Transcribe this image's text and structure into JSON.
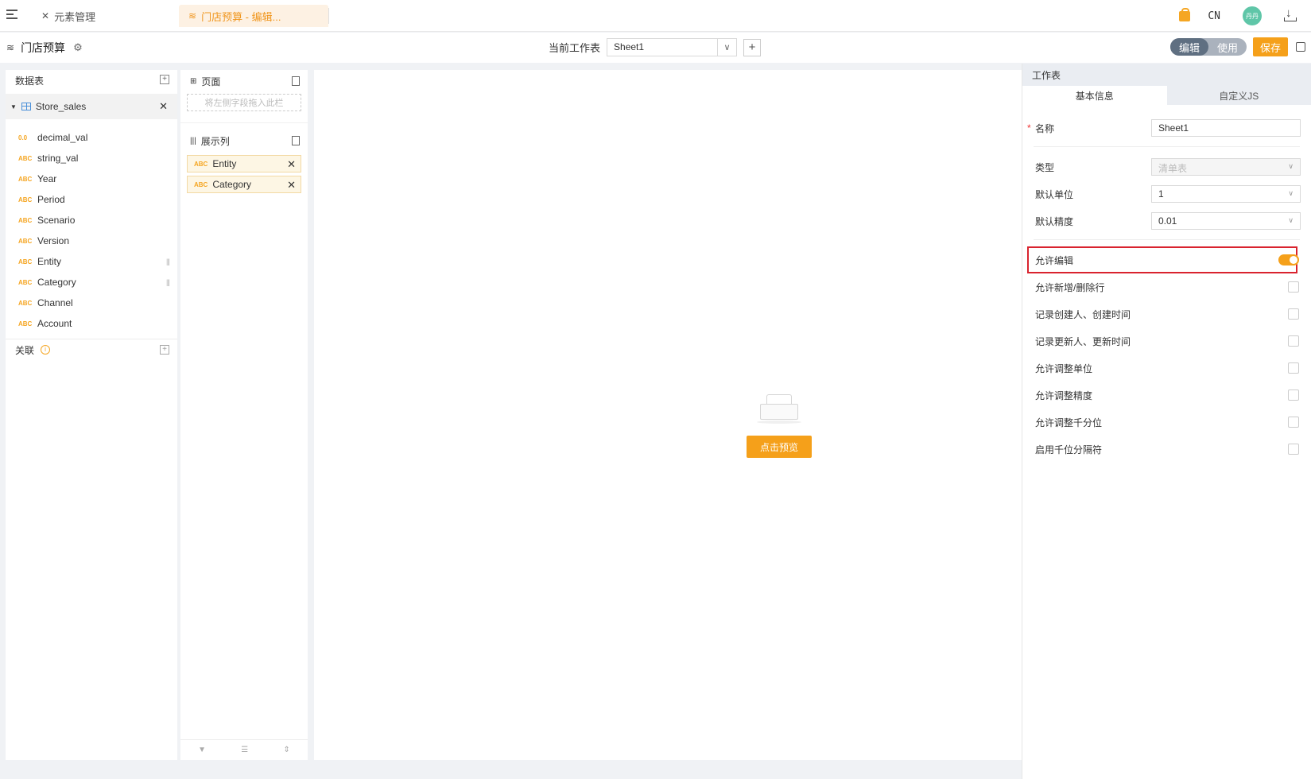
{
  "topbar": {
    "tabs": [
      {
        "label": "元素管理",
        "icon": "tools-icon"
      },
      {
        "label": "门店预算 - 编辑...",
        "icon": "layers-icon"
      }
    ],
    "lang": "CN",
    "avatar": "丹丹"
  },
  "toolbar": {
    "title": "门店预算",
    "sheet_label": "当前工作表",
    "sheet_value": "Sheet1",
    "mode_edit": "编辑",
    "mode_use": "使用",
    "save": "保存"
  },
  "data_panel": {
    "title": "数据表",
    "table": "Store_sales",
    "fields": [
      {
        "type": "0.0",
        "name": "decimal_val",
        "used": false
      },
      {
        "type": "ABC",
        "name": "string_val",
        "used": false
      },
      {
        "type": "ABC",
        "name": "Year",
        "used": false
      },
      {
        "type": "ABC",
        "name": "Period",
        "used": false
      },
      {
        "type": "ABC",
        "name": "Scenario",
        "used": false
      },
      {
        "type": "ABC",
        "name": "Version",
        "used": false
      },
      {
        "type": "ABC",
        "name": "Entity",
        "used": true
      },
      {
        "type": "ABC",
        "name": "Category",
        "used": true
      },
      {
        "type": "ABC",
        "name": "Channel",
        "used": false
      },
      {
        "type": "ABC",
        "name": "Account",
        "used": false
      }
    ],
    "relation": "关联"
  },
  "fields_panel": {
    "page_title": "页面",
    "drop_hint": "将左侧字段拖入此栏",
    "columns_title": "展示列",
    "columns": [
      {
        "type": "ABC",
        "name": "Entity"
      },
      {
        "type": "ABC",
        "name": "Category"
      }
    ]
  },
  "canvas": {
    "preview": "点击预览"
  },
  "props": {
    "title": "工作表",
    "tabs": [
      "基本信息",
      "自定义JS"
    ],
    "name_label": "名称",
    "name_value": "Sheet1",
    "type_label": "类型",
    "type_value": "清单表",
    "unit_label": "默认单位",
    "unit_value": "1",
    "precision_label": "默认精度",
    "precision_value": "0.01",
    "allow_edit": "允许编辑",
    "options": [
      "允许新增/删除行",
      "记录创建人、创建时间",
      "记录更新人、更新时间",
      "允许调整单位",
      "允许调整精度",
      "允许调整千分位",
      "启用千位分隔符"
    ]
  }
}
